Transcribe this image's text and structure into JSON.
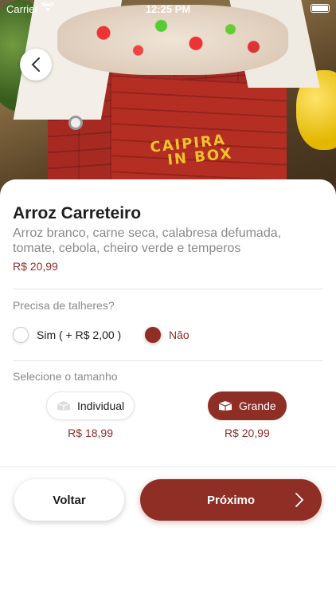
{
  "status_bar": {
    "carrier": "Carrier",
    "time": "12:25 PM"
  },
  "hero": {
    "logo_text_line1": "CAIPIRA",
    "logo_text_line2": "IN BOX"
  },
  "product": {
    "name": "Arroz Carreteiro",
    "description": "Arroz branco, carne seca, calabresa defumada, tomate, cebola, cheiro verde e temperos",
    "price": "R$ 20,99"
  },
  "cutlery": {
    "label": "Precisa de talheres?",
    "options": [
      {
        "label": "Sim ( + R$ 2,00 )",
        "selected": false
      },
      {
        "label": "Não",
        "selected": true
      }
    ]
  },
  "sizes": {
    "label": "Selecione o tamanho",
    "options": [
      {
        "label": "Individual",
        "price": "R$ 18,99",
        "selected": false,
        "icon": "box-icon"
      },
      {
        "label": "Grande",
        "price": "R$ 20,99",
        "selected": true,
        "icon": "box-icon"
      }
    ]
  },
  "actions": {
    "back_label": "Voltar",
    "next_label": "Próximo"
  },
  "colors": {
    "accent": "#8e2e25",
    "muted_text": "#8a8a8a"
  }
}
